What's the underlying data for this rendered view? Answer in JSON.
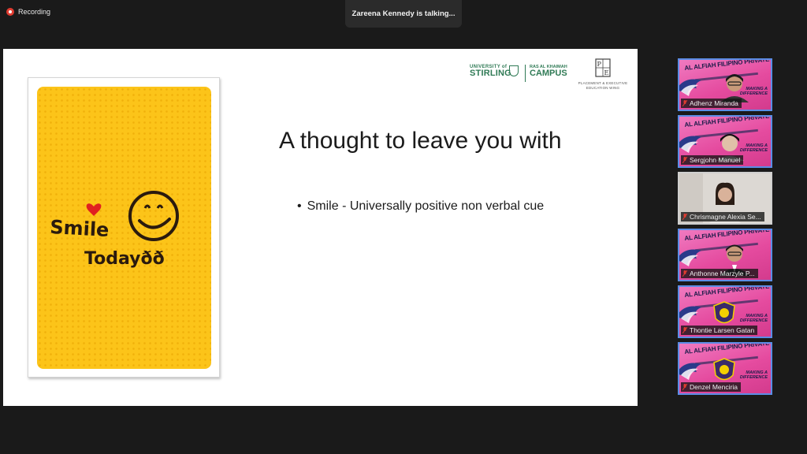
{
  "recording": {
    "label": "Recording"
  },
  "talking": {
    "text": "Zareena Kennedy is talking..."
  },
  "slide": {
    "title": "A thought to leave you with",
    "bullets": [
      "Smile - Universally positive non verbal cue"
    ],
    "image_text": {
      "line1": "Smile",
      "line2": "Todayðð"
    },
    "logos": {
      "university_small": "UNIVERSITY of",
      "university_big": "STIRLING",
      "campus_small": "RAS AL KHAIMAH",
      "campus_big": "CAMPUS",
      "pe_letters": "PE",
      "pe_line1": "PLACEMENT & EXECUTIVE",
      "pe_line2": "EDUCATION WING"
    }
  },
  "participants": [
    {
      "name": "Adhenz Miranda",
      "type": "school"
    },
    {
      "name": "Sergjohn Manuel",
      "type": "school"
    },
    {
      "name": "Chrismagne Alexia Se...",
      "type": "camera"
    },
    {
      "name": "Anthonne Marzyle P...",
      "type": "school"
    },
    {
      "name": "Thontie Larsen Gatan",
      "type": "school"
    },
    {
      "name": "Denzel Menciria",
      "type": "school"
    }
  ],
  "school_banner": {
    "name": "AL ALFIAH FILIPINO PRIVATE SCHOOL",
    "tagline1": "MAKING A",
    "tagline2": "DIFFERENCE"
  },
  "colors": {
    "accent_border": "#5b8de6",
    "recording_red": "#e03c31",
    "muted_mic": "#e03c31",
    "slide_yellow": "#fcc419"
  },
  "icons": {
    "recording": "record-dot-icon",
    "mic": "muted-mic-icon"
  }
}
